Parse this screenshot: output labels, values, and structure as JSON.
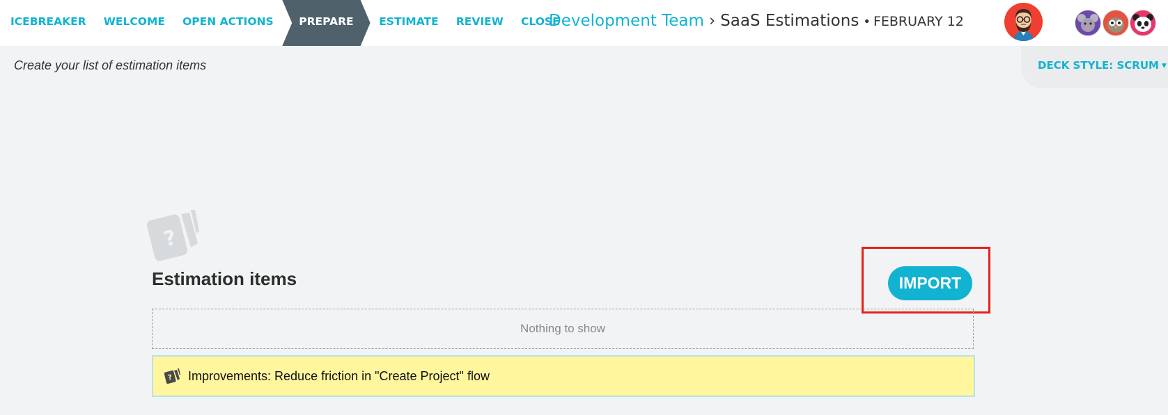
{
  "nav": {
    "steps": [
      {
        "label": "ICEBREAKER"
      },
      {
        "label": "WELCOME"
      },
      {
        "label": "OPEN ACTIONS"
      },
      {
        "label": "PREPARE"
      },
      {
        "label": "ESTIMATE"
      },
      {
        "label": "REVIEW"
      },
      {
        "label": "CLOSE"
      }
    ],
    "active_step": "PREPARE"
  },
  "breadcrumb": {
    "team": "Development Team",
    "separator": "›",
    "board": "SaaS Estimations",
    "dot": "•",
    "date": "FEBRUARY 12"
  },
  "subtitle": "Create your list of estimation items",
  "deck_style": {
    "label": "DECK STYLE: SCRUM",
    "caret": "▼"
  },
  "section": {
    "title": "Estimation items",
    "import_label": "IMPORT",
    "empty_text": "Nothing to show"
  },
  "new_item": {
    "value": "Improvements: Reduce friction in \"Create Project\" flow"
  },
  "icons": {
    "cards": "estimation-cards-icon",
    "main_avatar": "hipster-avatar",
    "peers": [
      "mouse-avatar",
      "owl-avatar",
      "panda-avatar"
    ]
  },
  "colors": {
    "accent": "#12b3d1",
    "active_step": "#4f626c",
    "highlight_frame": "#e3221b",
    "new_item_bg": "#fff69e"
  }
}
